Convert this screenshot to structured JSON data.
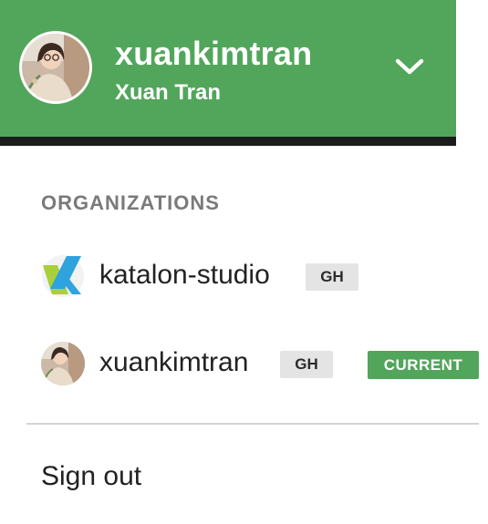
{
  "header": {
    "username": "xuankimtran",
    "full_name": "Xuan Tran",
    "avatar_icon": "user-avatar",
    "toggle_icon": "chevron-down-icon",
    "background_color": "#51a65b"
  },
  "organizations": {
    "title": "ORGANIZATIONS",
    "items": [
      {
        "name": "katalon-studio",
        "provider_badge": "GH",
        "logo_icon": "katalon-logo"
      },
      {
        "name": "xuankimtran",
        "provider_badge": "GH",
        "status_badge": "CURRENT",
        "logo_icon": "user-avatar"
      }
    ]
  },
  "menu": {
    "sign_out_label": "Sign out"
  },
  "colors": {
    "accent": "#51a65b",
    "badge_bg": "#e4e4e4",
    "section_title": "#7a7a7a",
    "divider": "#d4d4d4"
  }
}
